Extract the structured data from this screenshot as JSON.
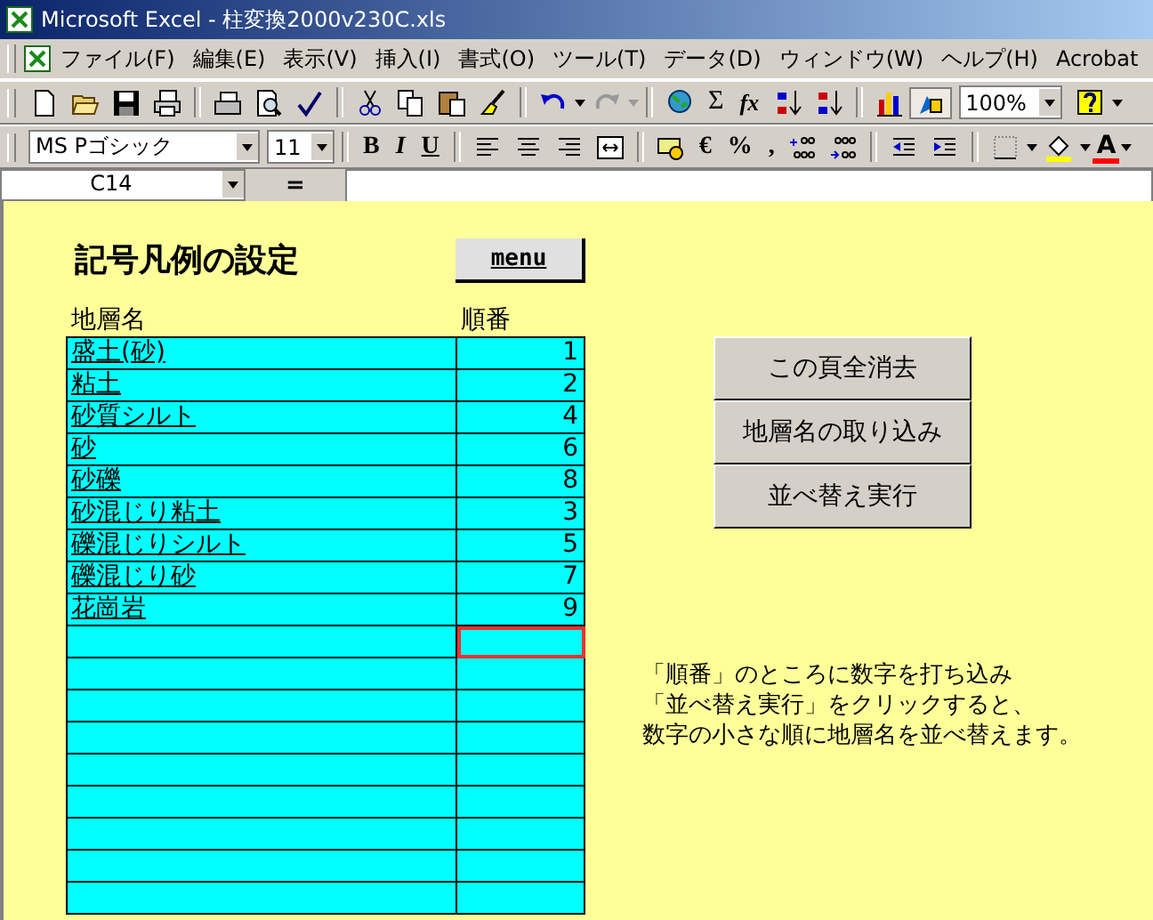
{
  "window": {
    "title": "Microsoft Excel - 柱変換2000v230C.xls"
  },
  "menu_bar": [
    "ファイル(F)",
    "編集(E)",
    "表示(V)",
    "挿入(I)",
    "書式(O)",
    "ツール(T)",
    "データ(D)",
    "ウィンドウ(W)",
    "ヘルプ(H)",
    "Acrobat"
  ],
  "standard_toolbar": {
    "sum": "Σ",
    "function": "fx",
    "zoom": "100%"
  },
  "format_toolbar": {
    "font": "MS Pゴシック",
    "size": "11",
    "bold": "B",
    "italic": "I",
    "underline": "U",
    "euro": "€",
    "percent": "%",
    "comma": ",",
    "font_color": "A"
  },
  "formula_bar": {
    "name_box": "C14",
    "equals": "="
  },
  "sheet": {
    "title": "記号凡例の設定",
    "menu_button": "menu",
    "columns": [
      "地層名",
      "順番"
    ],
    "rows": [
      {
        "name": "盛土(砂)",
        "order": "1",
        "selected": false
      },
      {
        "name": "粘土",
        "order": "2",
        "selected": false
      },
      {
        "name": "砂質シルト",
        "order": "4",
        "selected": false
      },
      {
        "name": "砂",
        "order": "6",
        "selected": false
      },
      {
        "name": "砂礫",
        "order": "8",
        "selected": false
      },
      {
        "name": "砂混じり粘土",
        "order": "3",
        "selected": false
      },
      {
        "name": "礫混じりシルト",
        "order": "5",
        "selected": false
      },
      {
        "name": "礫混じり砂",
        "order": "7",
        "selected": false
      },
      {
        "name": "花崗岩",
        "order": "9",
        "selected": false
      },
      {
        "selected": true
      },
      {
        "selected": false
      },
      {
        "selected": false
      },
      {
        "selected": false
      },
      {
        "selected": false
      },
      {
        "selected": false
      },
      {
        "selected": false
      },
      {
        "selected": false
      },
      {
        "selected": false
      }
    ],
    "buttons": [
      "この頁全消去",
      "地層名の取り込み",
      "並べ替え実行"
    ],
    "note": [
      "「順番」のところに数字を打ち込み",
      "「並べ替え実行」をクリックすると、",
      "数字の小さな順に地層名を並べ替えます。"
    ]
  }
}
